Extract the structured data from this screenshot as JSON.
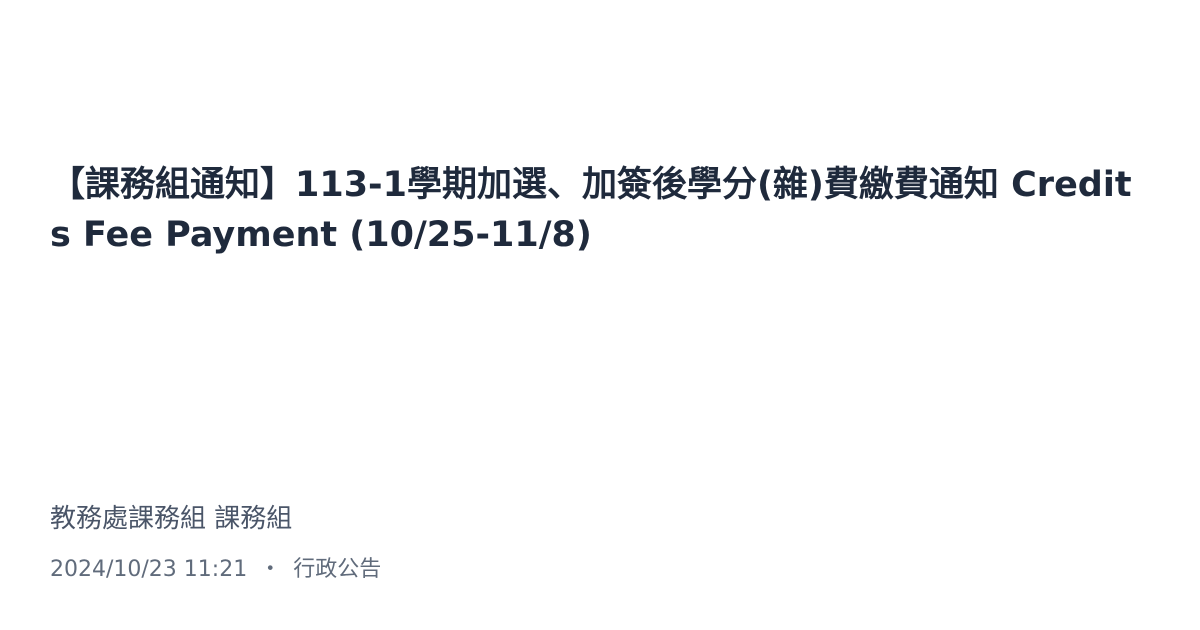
{
  "post": {
    "title": "【課務組通知】113-1學期加選、加簽後學分(雜)費繳費通知 Credits Fee Payment (10/25-11/8)",
    "author": "教務處課務組 課務組",
    "datetime": "2024/10/23 11:21",
    "separator": "・",
    "category": "行政公告"
  },
  "colors": {
    "title": "#1f2a3c",
    "author": "#4a5568",
    "meta": "#606b7b",
    "background": "#ffffff"
  }
}
